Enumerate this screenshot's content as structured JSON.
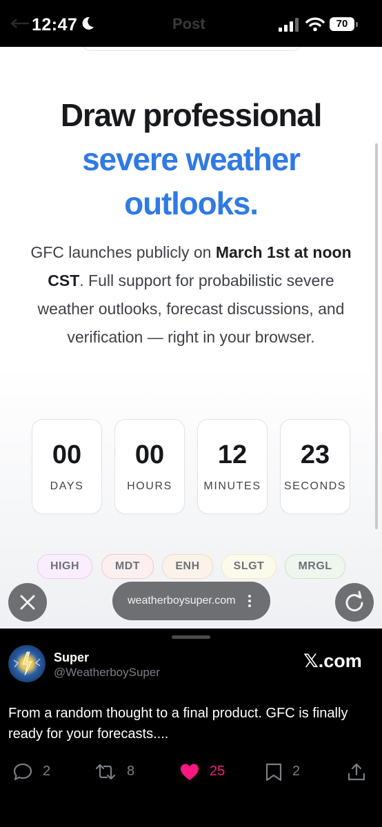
{
  "status_bar": {
    "time": "12:47",
    "faded_label": "Post",
    "battery": "70"
  },
  "page": {
    "headline_line1": "Draw professional",
    "headline_line2": "severe weather",
    "headline_line3": "outlooks.",
    "desc_part1": "GFC launches publicly on ",
    "desc_bold": "March 1st at noon CST",
    "desc_part2": ". Full support for probabilistic severe weather outlooks, forecast discussions, and verification — right in your browser.",
    "accent_color": "#2f7ae5",
    "countdown": [
      {
        "value": "00",
        "label": "DAYS"
      },
      {
        "value": "00",
        "label": "HOURS"
      },
      {
        "value": "12",
        "label": "MINUTES"
      },
      {
        "value": "23",
        "label": "SECONDS"
      }
    ],
    "risk_levels": [
      {
        "label": "HIGH",
        "color": "#c84fd0"
      },
      {
        "label": "MDT",
        "color": "#e06666"
      },
      {
        "label": "ENH",
        "color": "#e6a15a"
      },
      {
        "label": "SLGT",
        "color": "#eedd6a"
      },
      {
        "label": "MRGL",
        "color": "#7fc47f"
      }
    ]
  },
  "browser": {
    "url": "weatherboysuper.com"
  },
  "post": {
    "display_name": "Super",
    "handle": "@WeatherboySuper",
    "source": "𝕏.com",
    "text": "From a random thought to a final product. GFC is finally ready for your forecasts....",
    "replies": "2",
    "reposts": "8",
    "likes": "25",
    "bookmarks": "2",
    "like_color": "#f91880"
  }
}
